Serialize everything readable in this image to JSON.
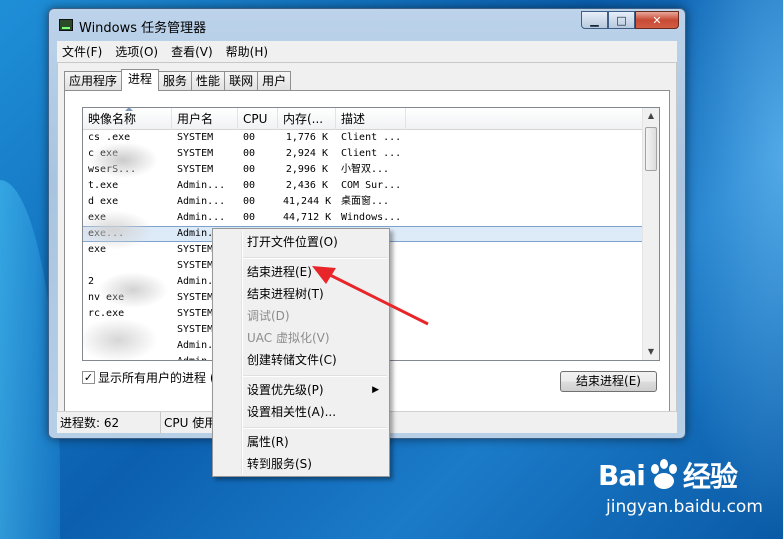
{
  "window": {
    "title": "Windows 任务管理器",
    "controls": {
      "minimize": "▁",
      "maximize": "□",
      "close": "✕"
    }
  },
  "menubar": [
    "文件(F)",
    "选项(O)",
    "查看(V)",
    "帮助(H)"
  ],
  "tabs": [
    {
      "label": "应用程序",
      "active": false
    },
    {
      "label": "进程",
      "active": true
    },
    {
      "label": "服务",
      "active": false
    },
    {
      "label": "性能",
      "active": false
    },
    {
      "label": "联网",
      "active": false
    },
    {
      "label": "用户",
      "active": false
    }
  ],
  "columns": [
    "映像名称",
    "用户名",
    "CPU",
    "内存(...",
    "描述"
  ],
  "rows": [
    {
      "image": "cs    .exe",
      "user": "SYSTEM",
      "cpu": "00",
      "mem": "1,776 K",
      "desc": "Client ..."
    },
    {
      "image": "c      exe",
      "user": "SYSTEM",
      "cpu": "00",
      "mem": "2,924 K",
      "desc": "Client ..."
    },
    {
      "image": "  wserS...",
      "user": "SYSTEM",
      "cpu": "00",
      "mem": "2,996 K",
      "desc": "小智双..."
    },
    {
      "image": "    t.exe",
      "user": "Admin...",
      "cpu": "00",
      "mem": "2,436 K",
      "desc": "COM Sur..."
    },
    {
      "image": "d    exe",
      "user": "Admin...",
      "cpu": "00",
      "mem": "41,244 K",
      "desc": "桌面窗..."
    },
    {
      "image": "        exe",
      "user": "Admin...",
      "cpu": "00",
      "mem": "44,712 K",
      "desc": "Windows..."
    },
    {
      "image": "     exe...",
      "user": "Admin...",
      "cpu": "",
      "mem": "",
      "desc": "",
      "selected": true
    },
    {
      "image": "        exe",
      "user": "SYSTEM",
      "cpu": "",
      "mem": "",
      "desc": ""
    },
    {
      "image": "",
      "user": "SYSTEM",
      "cpu": "",
      "mem": "",
      "desc": ""
    },
    {
      "image": "         2",
      "user": "Admin...",
      "cpu": "",
      "mem": "",
      "desc": ""
    },
    {
      "image": "nv      exe",
      "user": "SYSTEM",
      "cpu": "",
      "mem": "",
      "desc": ""
    },
    {
      "image": "    rc.exe",
      "user": "SYSTEM",
      "cpu": "",
      "mem": "",
      "desc": ""
    },
    {
      "image": "",
      "user": "SYSTEM",
      "cpu": "",
      "mem": "",
      "desc": ""
    },
    {
      "image": "",
      "user": "Admin...",
      "cpu": "",
      "mem": "",
      "desc": ""
    },
    {
      "image": "",
      "user": "Admin...",
      "cpu": "",
      "mem": "",
      "desc": ""
    }
  ],
  "show_all_label": "显示所有用户的进程 (S",
  "show_all_checked": true,
  "end_process_button": "结束进程(E)",
  "status": {
    "processes": "进程数: 62",
    "cpu": "CPU 使用"
  },
  "context_menu": [
    {
      "label": "打开文件位置(O)",
      "enabled": true
    },
    {
      "label": "结束进程(E)",
      "enabled": true
    },
    {
      "label": "结束进程树(T)",
      "enabled": true
    },
    {
      "label": "调试(D)",
      "enabled": false
    },
    {
      "label": "UAC 虚拟化(V)",
      "enabled": false
    },
    {
      "label": "创建转储文件(C)",
      "enabled": true
    },
    {
      "label": "设置优先级(P)",
      "enabled": true,
      "submenu": true
    },
    {
      "label": "设置相关性(A)...",
      "enabled": true
    },
    {
      "label": "属性(R)",
      "enabled": true
    },
    {
      "label": "转到服务(S)",
      "enabled": true
    }
  ],
  "annotation_color": "#e8262a",
  "watermark": {
    "brand_left": "Bai",
    "brand_right": "经验",
    "url": "jingyan.baidu.com"
  }
}
